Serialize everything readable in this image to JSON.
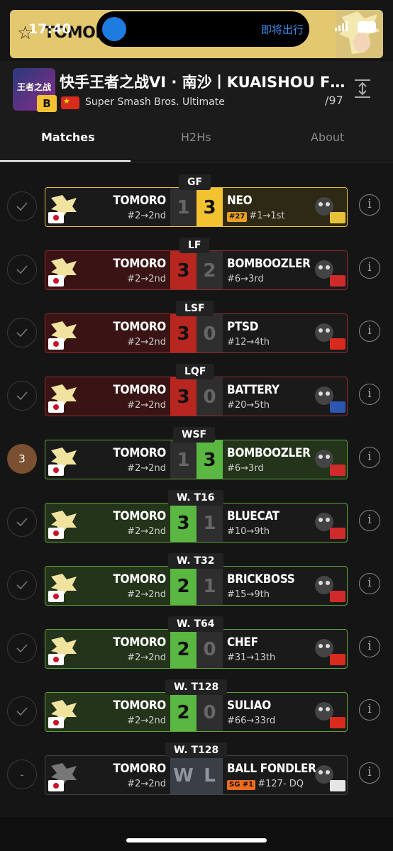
{
  "status_bar": {
    "time": "17:40",
    "live_activity_text": "即将出行",
    "battery": "99"
  },
  "banner": {
    "player_name": "TOMORO"
  },
  "tournament": {
    "title": "快手王者之战VI · 南沙丨KUAISHOU FIGHTCL...",
    "logo_text": "王者之战",
    "tier": "B",
    "game": "Super Smash Bros. Ultimate",
    "count": "/97"
  },
  "tabs": [
    {
      "label": "Matches",
      "active": true
    },
    {
      "label": "H2Hs",
      "active": false
    },
    {
      "label": "About",
      "active": false
    }
  ],
  "matches": [
    {
      "round": "GF",
      "status": "check",
      "p1": {
        "name": "TOMORO",
        "seed": "#2→2nd",
        "score": "1"
      },
      "p2": {
        "name": "NEO",
        "badge": "#27",
        "seed": "#1→1st",
        "score": "3"
      },
      "result": "loss",
      "style": "gold"
    },
    {
      "round": "LF",
      "status": "check",
      "p1": {
        "name": "TOMORO",
        "seed": "#2→2nd",
        "score": "3"
      },
      "p2": {
        "name": "BOMBOOZLER",
        "seed": "#6→3rd",
        "score": "2"
      },
      "result": "win",
      "style": "red"
    },
    {
      "round": "LSF",
      "status": "check",
      "p1": {
        "name": "TOMORO",
        "seed": "#2→2nd",
        "score": "3"
      },
      "p2": {
        "name": "PTSD",
        "seed": "#12→4th",
        "score": "0"
      },
      "result": "win",
      "style": "red"
    },
    {
      "round": "LQF",
      "status": "check",
      "p1": {
        "name": "TOMORO",
        "seed": "#2→2nd",
        "score": "3"
      },
      "p2": {
        "name": "BATTERY",
        "seed": "#20→5th",
        "score": "0"
      },
      "result": "win",
      "style": "red"
    },
    {
      "round": "WSF",
      "status": "3",
      "p1": {
        "name": "TOMORO",
        "seed": "#2→2nd",
        "score": "1"
      },
      "p2": {
        "name": "BOMBOOZLER",
        "seed": "#6→3rd",
        "score": "3"
      },
      "result": "loss",
      "style": "green"
    },
    {
      "round": "W. T16",
      "status": "check",
      "p1": {
        "name": "TOMORO",
        "seed": "#2→2nd",
        "score": "3"
      },
      "p2": {
        "name": "BLUECAT",
        "seed": "#10→9th",
        "score": "1"
      },
      "result": "win",
      "style": "green"
    },
    {
      "round": "W. T32",
      "status": "check",
      "p1": {
        "name": "TOMORO",
        "seed": "#2→2nd",
        "score": "2"
      },
      "p2": {
        "name": "BRICKBOSS",
        "seed": "#15→9th",
        "score": "1"
      },
      "result": "win",
      "style": "green"
    },
    {
      "round": "W. T64",
      "status": "check",
      "p1": {
        "name": "TOMORO",
        "seed": "#2→2nd",
        "score": "2"
      },
      "p2": {
        "name": "CHEF",
        "seed": "#31→13th",
        "score": "0"
      },
      "result": "win",
      "style": "green"
    },
    {
      "round": "W. T128",
      "status": "check",
      "p1": {
        "name": "TOMORO",
        "seed": "#2→2nd",
        "score": "2"
      },
      "p2": {
        "name": "SULIAO",
        "seed": "#66→33rd",
        "score": "0"
      },
      "result": "win",
      "style": "green"
    },
    {
      "round": "W. T128",
      "status": "-",
      "p1": {
        "name": "TOMORO",
        "seed": "#2→2nd",
        "score": "W"
      },
      "p2": {
        "name": "BALL FONDLER",
        "badge": "SG #1",
        "seed": "#127- DQ",
        "score": "L"
      },
      "result": "dq",
      "style": "none"
    }
  ],
  "colors": {
    "win_red": "#b7261f",
    "win_green": "#59b742",
    "gold": "#f2c230",
    "background": "#151515"
  },
  "icons": [
    "star-icon",
    "check-icon",
    "info-icon",
    "expand-icon"
  ]
}
